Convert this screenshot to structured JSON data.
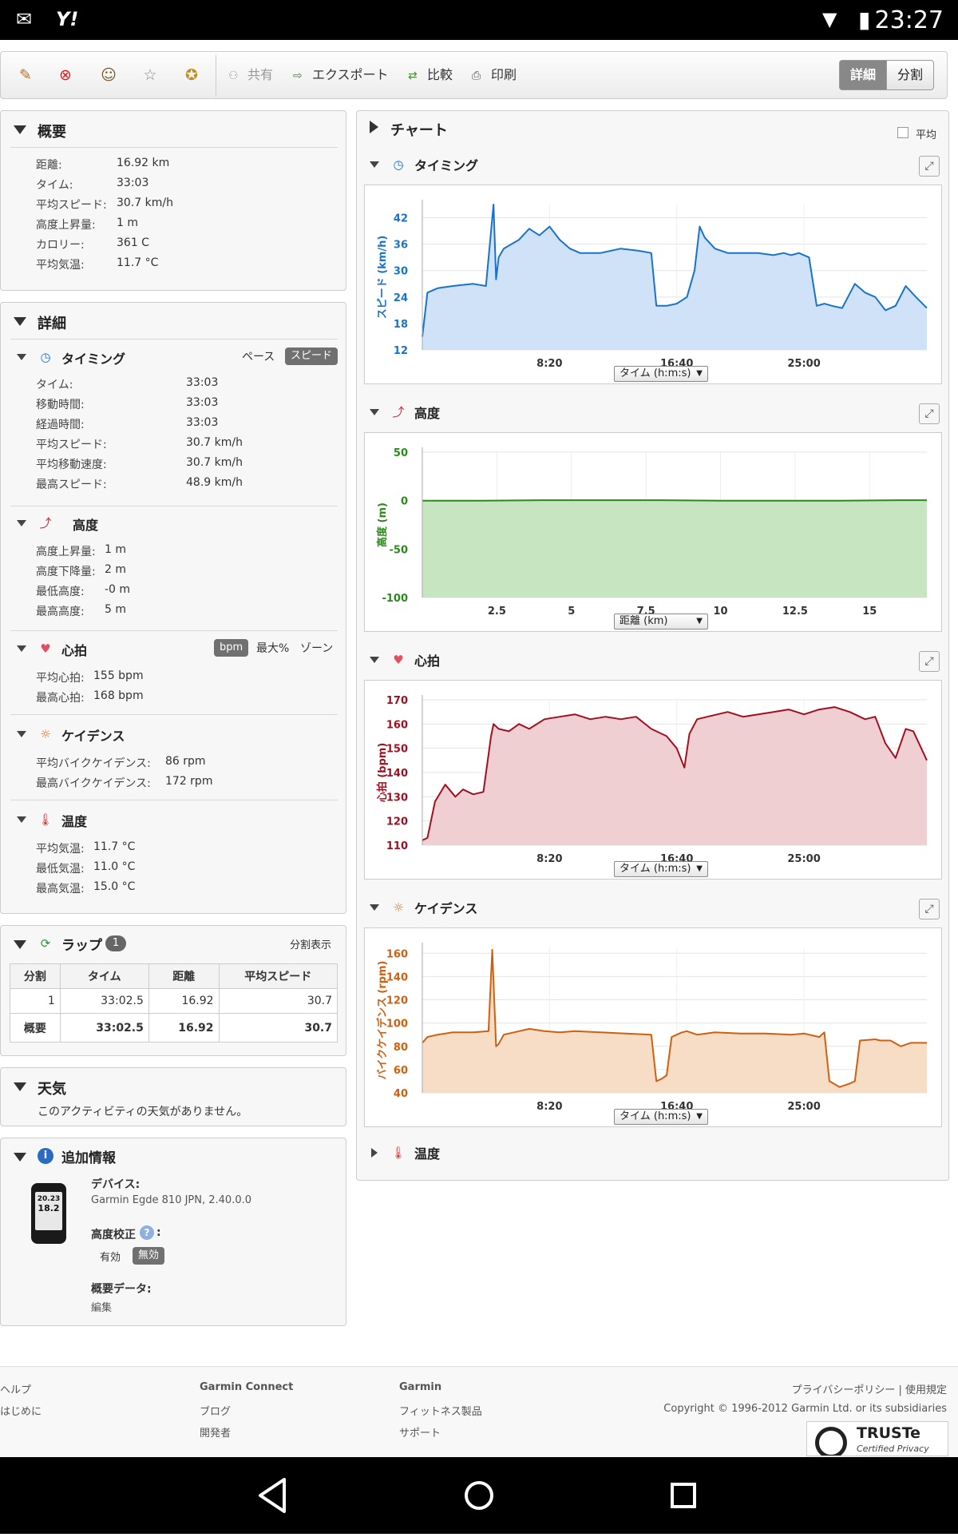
{
  "status_bar": {
    "time": "23:27",
    "left_icons": [
      "gmail-icon",
      "yahoo-icon"
    ],
    "right_icons": [
      "wifi-icon",
      "battery-icon"
    ]
  },
  "toolbar": {
    "icons": [
      "edit-icon",
      "delete-icon",
      "person-icon",
      "star-icon",
      "award-icon"
    ],
    "share_label": "共有",
    "export_label": "エクスポート",
    "compare_label": "比較",
    "print_label": "印刷",
    "view_detail_label": "詳細",
    "view_split_label": "分割"
  },
  "summary": {
    "title": "概要",
    "rows": [
      {
        "label": "距離:",
        "value": "16.92 km"
      },
      {
        "label": "タイム:",
        "value": "33:03"
      },
      {
        "label": "平均スピード:",
        "value": "30.7 km/h"
      },
      {
        "label": "高度上昇量:",
        "value": "1 m"
      },
      {
        "label": "カロリー:",
        "value": "361 C"
      },
      {
        "label": "平均気温:",
        "value": "11.7 °C"
      }
    ]
  },
  "details": {
    "title": "詳細",
    "timing": {
      "title": "タイミング",
      "opt_pace": "ペース",
      "opt_speed": "スピード",
      "rows": [
        {
          "label": "タイム:",
          "value": "33:03"
        },
        {
          "label": "移動時間:",
          "value": "33:03"
        },
        {
          "label": "経過時間:",
          "value": "33:03"
        },
        {
          "label": "平均スピード:",
          "value": "30.7 km/h"
        },
        {
          "label": "平均移動速度:",
          "value": "30.7 km/h"
        },
        {
          "label": "最高スピード:",
          "value": "48.9 km/h"
        }
      ]
    },
    "elevation": {
      "title": "高度",
      "rows": [
        {
          "label": "高度上昇量:",
          "value": "1 m"
        },
        {
          "label": "高度下降量:",
          "value": "2 m"
        },
        {
          "label": "最低高度:",
          "value": "-0 m"
        },
        {
          "label": "最高高度:",
          "value": "5 m"
        }
      ]
    },
    "heart": {
      "title": "心拍",
      "opt_bpm": "bpm",
      "opt_max": "最大%",
      "opt_zone": "ゾーン",
      "rows": [
        {
          "label": "平均心拍:",
          "value": "155 bpm"
        },
        {
          "label": "最高心拍:",
          "value": "168 bpm"
        }
      ]
    },
    "cadence": {
      "title": "ケイデンス",
      "rows": [
        {
          "label": "平均バイクケイデンス:",
          "value": "86 rpm"
        },
        {
          "label": "最高バイクケイデンス:",
          "value": "172 rpm"
        }
      ]
    },
    "temperature": {
      "title": "温度",
      "rows": [
        {
          "label": "平均気温:",
          "value": "11.7 °C"
        },
        {
          "label": "最低気温:",
          "value": "11.0 °C"
        },
        {
          "label": "最高気温:",
          "value": "15.0 °C"
        }
      ]
    }
  },
  "laps": {
    "title": "ラップ",
    "count": "1",
    "split_view": "分割表示",
    "columns": [
      "分割",
      "タイム",
      "距離",
      "平均スピード"
    ],
    "rows": [
      {
        "split": "1",
        "time": "33:02.5",
        "distance": "16.92",
        "speed": "30.7"
      }
    ],
    "total": {
      "split": "概要",
      "time": "33:02.5",
      "distance": "16.92",
      "speed": "30.7"
    }
  },
  "weather": {
    "title": "天気",
    "message": "このアクティビティの天気がありません。"
  },
  "extra": {
    "title": "追加情報",
    "device_label": "デバイス:",
    "device_value": "Garmin Egde 810 JPN, 2.40.0.0",
    "device_screen_1": "20.23",
    "device_screen_2": "18.2",
    "elevation_correction_label": "高度校正",
    "correction_colon": ":",
    "enabled_label": "有効",
    "disabled_label": "無効",
    "summary_data_label": "概要データ:",
    "edit_label": "編集"
  },
  "charts_header": {
    "title": "チャート",
    "average_label": "平均"
  },
  "chart_data": [
    {
      "type": "area",
      "title": "タイミング",
      "ylabel": "スピード (km/h)",
      "ylim": [
        12,
        45
      ],
      "yticks": [
        "12",
        "18",
        "24",
        "30",
        "36",
        "42"
      ],
      "xticks": [
        {
          "x": 500,
          "label": "8:20"
        },
        {
          "x": 1000,
          "label": "16:40"
        },
        {
          "x": 1500,
          "label": "25:00"
        }
      ],
      "xlim": [
        0,
        1983
      ],
      "selector": "タイム (h:m:s)",
      "color": "#1a73c9",
      "fill": "#cfe2f7",
      "x": [
        0,
        20,
        60,
        120,
        200,
        250,
        280,
        290,
        300,
        320,
        380,
        420,
        460,
        500,
        540,
        580,
        620,
        700,
        780,
        850,
        900,
        920,
        960,
        1000,
        1040,
        1070,
        1090,
        1110,
        1150,
        1200,
        1260,
        1320,
        1380,
        1420,
        1450,
        1480,
        1520,
        1550,
        1580,
        1610,
        1650,
        1700,
        1740,
        1780,
        1820,
        1860,
        1900,
        1940,
        1983
      ],
      "y": [
        15,
        25,
        26,
        26.5,
        27,
        26.5,
        45,
        28,
        33,
        35,
        37,
        39.5,
        38,
        40,
        37,
        35,
        34,
        34,
        35,
        34.5,
        34,
        22,
        22,
        22.5,
        24,
        30,
        40,
        37.5,
        35,
        34,
        34,
        34,
        33.5,
        34,
        33.5,
        34,
        33,
        22,
        22.5,
        22,
        21.5,
        27,
        25,
        24,
        21,
        22,
        26.5,
        24,
        21.5
      ]
    },
    {
      "type": "area",
      "title": "高度",
      "ylabel": "高度 (m)",
      "ylim": [
        -100,
        50
      ],
      "yticks": [
        "-100",
        "-50",
        "0",
        "50"
      ],
      "xticks": [
        "2.5",
        "5",
        "7.5",
        "10",
        "12.5",
        "15"
      ],
      "xlim": [
        0,
        16.92
      ],
      "selector": "距離 (km)",
      "color": "#2a8a1a",
      "fill": "#c8e5c2",
      "x": [
        0,
        2,
        4,
        6,
        8,
        10,
        12,
        14,
        16,
        16.92
      ],
      "y": [
        0,
        0,
        0.5,
        0.5,
        0.5,
        0,
        0,
        0,
        0.5,
        0.5
      ]
    },
    {
      "type": "area",
      "title": "心拍",
      "ylabel": "心拍 (bpm)",
      "ylim": [
        110,
        170
      ],
      "yticks": [
        "110",
        "120",
        "130",
        "140",
        "150",
        "160",
        "170"
      ],
      "xticks": [
        {
          "x": 500,
          "label": "8:20"
        },
        {
          "x": 1000,
          "label": "16:40"
        },
        {
          "x": 1500,
          "label": "25:00"
        }
      ],
      "xlim": [
        0,
        1983
      ],
      "selector": "タイム (h:m:s)",
      "color": "#a01020",
      "fill": "#f0cfd2",
      "x": [
        0,
        20,
        50,
        90,
        130,
        160,
        200,
        240,
        270,
        280,
        300,
        340,
        380,
        420,
        480,
        540,
        600,
        660,
        720,
        780,
        840,
        900,
        960,
        1000,
        1030,
        1050,
        1080,
        1120,
        1200,
        1260,
        1320,
        1380,
        1440,
        1500,
        1560,
        1620,
        1680,
        1740,
        1780,
        1820,
        1860,
        1900,
        1930,
        1983
      ],
      "y": [
        112,
        113,
        128,
        135,
        130,
        133,
        131,
        132,
        155,
        160,
        158,
        157,
        160,
        158,
        162,
        163,
        164,
        162,
        163,
        162,
        163,
        158,
        155,
        150,
        142,
        156,
        162,
        163,
        165,
        163,
        164,
        165,
        166,
        164,
        166,
        167,
        165,
        162,
        163,
        152,
        146,
        158,
        157,
        145
      ]
    },
    {
      "type": "area",
      "title": "ケイデンス",
      "ylabel": "バイクケイデンス (rpm)",
      "ylim": [
        40,
        165
      ],
      "yticks": [
        "40",
        "60",
        "80",
        "100",
        "120",
        "140",
        "160"
      ],
      "xticks": [
        {
          "x": 500,
          "label": "8:20"
        },
        {
          "x": 1000,
          "label": "16:40"
        },
        {
          "x": 1500,
          "label": "25:00"
        }
      ],
      "xlim": [
        0,
        1983
      ],
      "selector": "タイム (h:m:s)",
      "color": "#d06010",
      "fill": "#f7dcc6",
      "x": [
        0,
        20,
        60,
        120,
        200,
        260,
        275,
        290,
        300,
        320,
        360,
        420,
        480,
        540,
        600,
        700,
        800,
        900,
        920,
        940,
        960,
        980,
        1000,
        1020,
        1040,
        1080,
        1150,
        1250,
        1350,
        1450,
        1500,
        1560,
        1580,
        1600,
        1640,
        1680,
        1700,
        1720,
        1780,
        1800,
        1840,
        1880,
        1920,
        1983
      ],
      "y": [
        83,
        88,
        90,
        92,
        92,
        93,
        163,
        80,
        82,
        90,
        92,
        95,
        93,
        92,
        93,
        92,
        91,
        90,
        50,
        52,
        55,
        88,
        90,
        92,
        93,
        90,
        92,
        91,
        91,
        90,
        91,
        88,
        92,
        50,
        45,
        48,
        50,
        85,
        86,
        85,
        85,
        80,
        83,
        83
      ]
    }
  ],
  "temp_chart": {
    "title": "温度"
  },
  "footer": {
    "col1": [
      "ヘルプ",
      "はじめに"
    ],
    "col2": [
      "Garmin Connect",
      "ブログ",
      "開発者"
    ],
    "col3": [
      "Garmin",
      "フィットネス製品",
      "サポート"
    ],
    "policy": "プライバシーポリシー | 使用規定",
    "copyright": "Copyright © 1996-2012 Garmin Ltd. or its subsidiaries",
    "truste_main": "TRUSTe",
    "truste_sub": "Certified Privacy"
  }
}
